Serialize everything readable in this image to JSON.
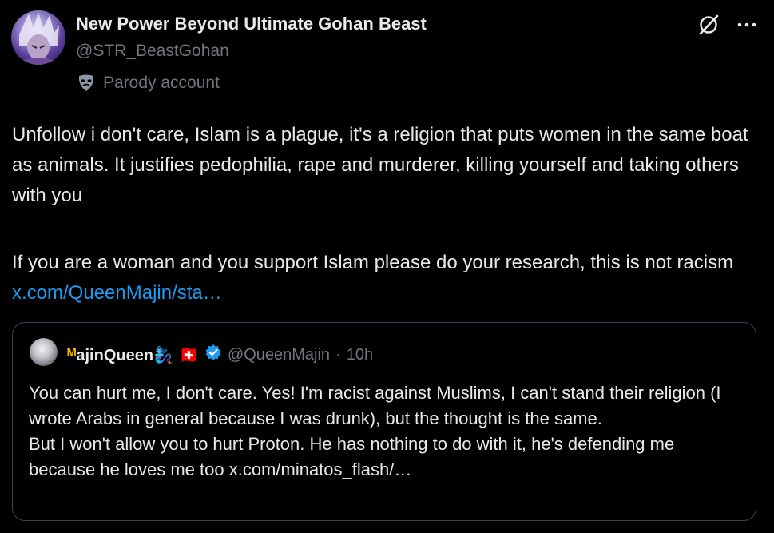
{
  "author": {
    "name": "New Power Beyond Ultimate Gohan Beast",
    "handle": "@STR_BeastGohan",
    "label": "Parody account"
  },
  "tweet": {
    "paragraph1": "Unfollow i don't care, Islam is a plague, it's a religion that puts women in the same boat as animals. It justifies pedophilia, rape and murderer, killing yourself and taking others with you",
    "paragraph2_text": "If you are a woman and you support Islam please do your research, this is not racism ",
    "paragraph2_link": "x.com/QueenMajin/sta…"
  },
  "quote": {
    "name_prefix": "ᴹ",
    "name": "ajinQueen",
    "name_emoji": "🧞‍♀️",
    "flag": "🇨🇭",
    "handle": "@QueenMajin",
    "separator": "·",
    "time": "10h",
    "line1": "You can hurt me, I don't care. Yes! I'm racist against Muslims, I can't stand their religion (I wrote Arabs in general because I was drunk), but the thought is the same.",
    "line2": "But I won't allow you to hurt Proton. He has nothing to do with it, he's defending me because he loves me too x.com/minatos_flash/…"
  },
  "icons": {
    "grok": "grok-icon",
    "more": "more-icon",
    "mask": "parody-mask-icon",
    "verified": "verified-badge-icon"
  },
  "colors": {
    "background": "#000000",
    "text": "#e7e9ea",
    "muted": "#71767b",
    "link": "#1d9bf0",
    "border": "#38444d"
  }
}
